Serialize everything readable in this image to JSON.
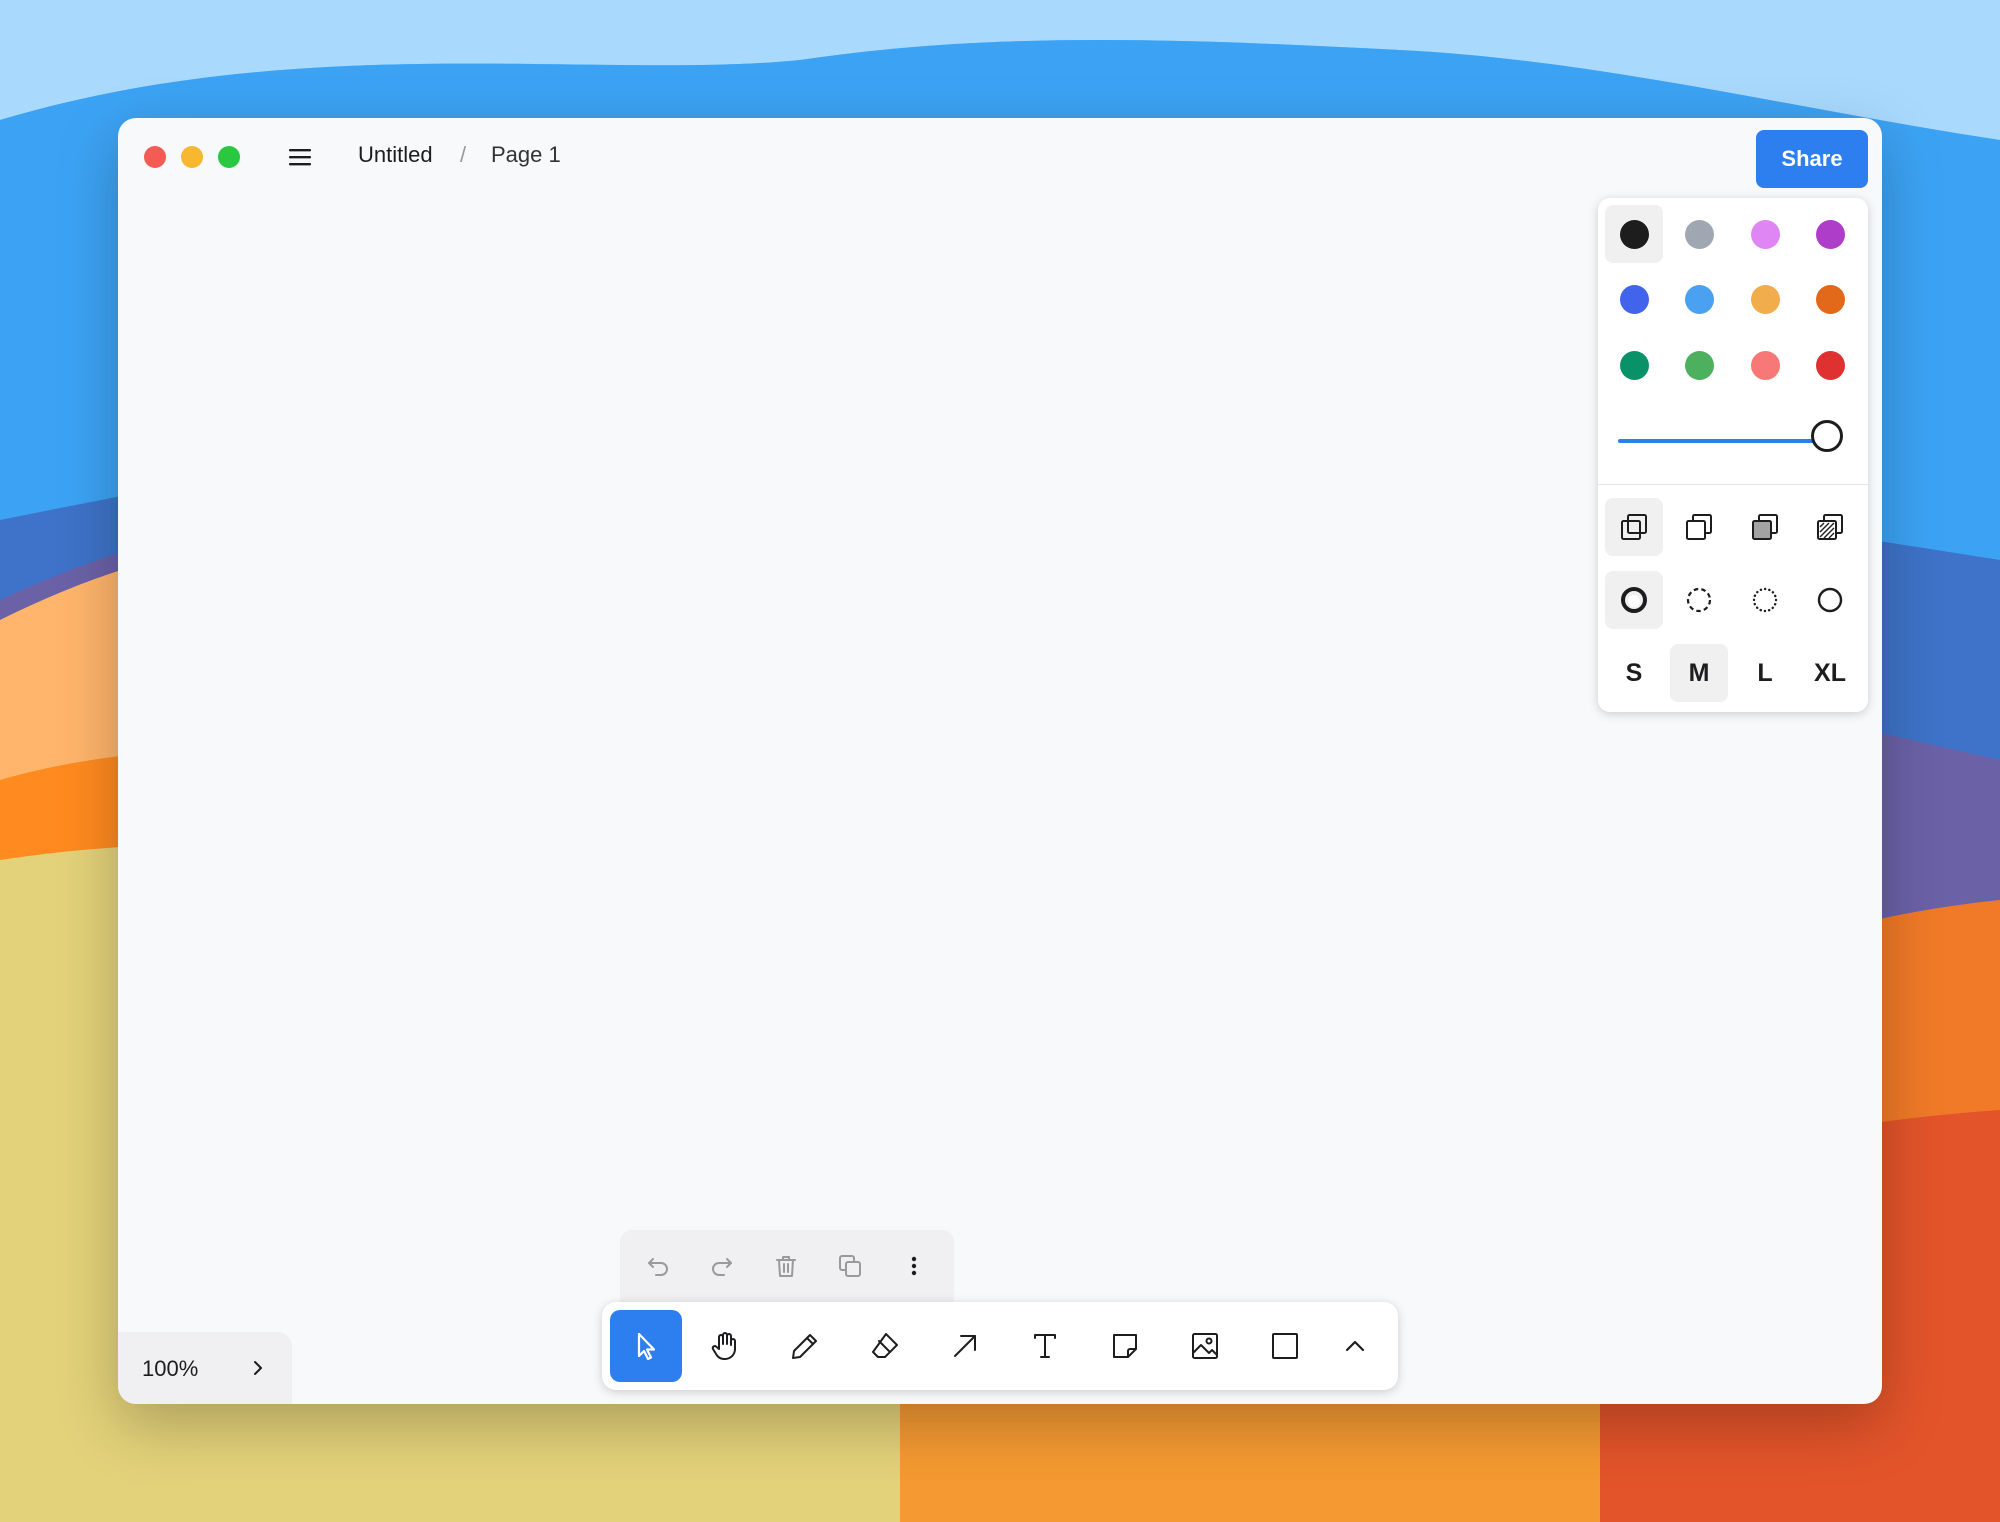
{
  "header": {
    "title": "Untitled",
    "separator": "/",
    "page": "Page 1",
    "share_label": "Share"
  },
  "window_controls": {
    "close_color": "#f25c54",
    "minimize_color": "#f7b731",
    "maximize_color": "#28c840"
  },
  "style_panel": {
    "colors": [
      {
        "name": "black",
        "hex": "#1d1d1d",
        "selected": true
      },
      {
        "name": "grey",
        "hex": "#9fa8b2"
      },
      {
        "name": "light-violet",
        "hex": "#e085f4"
      },
      {
        "name": "violet",
        "hex": "#ae3ec9"
      },
      {
        "name": "blue",
        "hex": "#4263eb"
      },
      {
        "name": "light-blue",
        "hex": "#4ba1f1"
      },
      {
        "name": "yellow",
        "hex": "#f1ac4b"
      },
      {
        "name": "orange",
        "hex": "#e16919"
      },
      {
        "name": "green",
        "hex": "#099268"
      },
      {
        "name": "light-green",
        "hex": "#4cb05e"
      },
      {
        "name": "light-red",
        "hex": "#f87777"
      },
      {
        "name": "red",
        "hex": "#e03131"
      }
    ],
    "opacity": 1.0,
    "fill_styles": [
      "fill-none-icon",
      "fill-semi-icon",
      "fill-solid-icon",
      "fill-pattern-icon"
    ],
    "dash_styles": [
      "dash-draw-icon",
      "dash-dashed-icon",
      "dash-dotted-icon",
      "dash-solid-icon"
    ],
    "sizes": [
      "S",
      "M",
      "L",
      "XL"
    ],
    "selected_size": "M"
  },
  "actions": [
    "undo-icon",
    "redo-icon",
    "trash-icon",
    "duplicate-icon",
    "more-vertical-icon"
  ],
  "tools": [
    "select-icon",
    "hand-icon",
    "pencil-icon",
    "eraser-icon",
    "arrow-icon",
    "text-icon",
    "note-icon",
    "image-icon",
    "rectangle-icon",
    "chevron-up-icon"
  ],
  "active_tool": "select-icon",
  "zoom": {
    "label": "100%"
  },
  "accent_color": "#2d7ff0"
}
